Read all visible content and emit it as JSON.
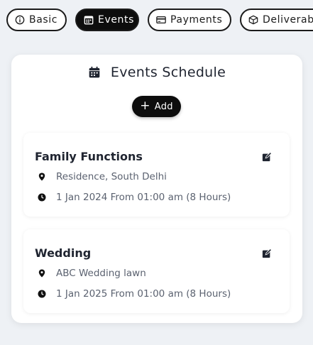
{
  "tabs": [
    {
      "label": "Basic",
      "icon": "info-icon",
      "active": false
    },
    {
      "label": "Events",
      "icon": "calendar-icon",
      "active": true
    },
    {
      "label": "Payments",
      "icon": "credit-card-icon",
      "active": false
    },
    {
      "label": "Deliverables",
      "icon": "box-icon",
      "active": false
    }
  ],
  "schedule": {
    "title": "Events Schedule",
    "add_label": "Add"
  },
  "events": [
    {
      "name": "Family Functions",
      "location": "Residence, South Delhi",
      "time": "1 Jan 2024 From 01:00 am (8 Hours)"
    },
    {
      "name": "Wedding",
      "location": "ABC Wedding lawn",
      "time": "1 Jan 2025 From 01:00 am (8 Hours)"
    }
  ],
  "colors": {
    "active_tab": "#0d0d0d",
    "background": "#eef1f5",
    "muted_text": "#5b6270"
  }
}
